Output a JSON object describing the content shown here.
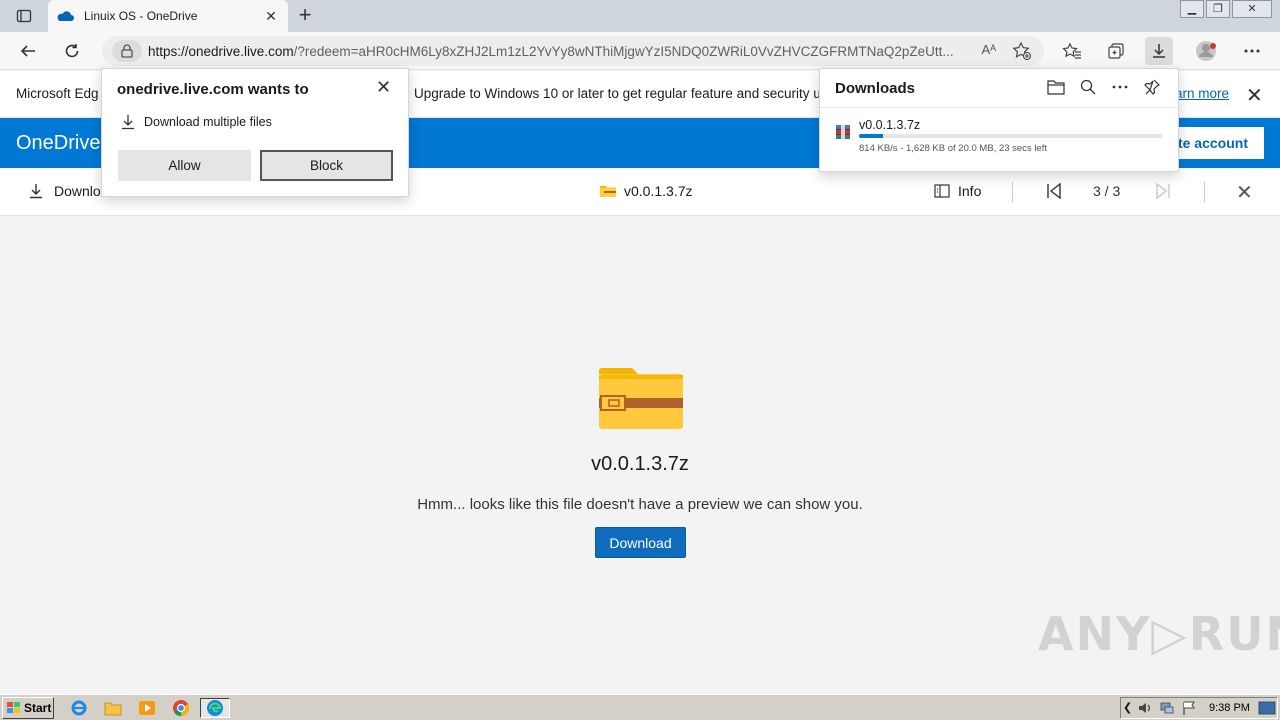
{
  "browser": {
    "tab_title": "Linuix OS - OneDrive",
    "url_host": "https://onedrive.live.com",
    "url_rest": "/?redeem=aHR0cHM6Ly8xZHJ2Lm1zL2YvYy8wNThiMjgwYzI5NDQ0ZWRiL0VvZHVCZGFRMTNaQ2pZeUtt...",
    "read_aloud": "Aᴬ"
  },
  "infobar": {
    "left_text": "Microsoft Edg",
    "middle_text": "Upgrade to Windows 10 or later to get regular feature and security u",
    "link_text": "arn more"
  },
  "onedrive": {
    "brand": "OneDrive",
    "create_account": "ate account"
  },
  "commandbar": {
    "download_label": "Downlo",
    "file_name": "v0.0.1.3.7z",
    "info_label": "Info",
    "page_counter": "3 / 3"
  },
  "preview": {
    "file_name": "v0.0.1.3.7z",
    "message": "Hmm... looks like this file doesn't have a preview we can show you.",
    "download_button": "Download"
  },
  "permission_popup": {
    "heading": "onedrive.live.com wants to",
    "request": "Download multiple files",
    "allow": "Allow",
    "block": "Block"
  },
  "downloads_panel": {
    "heading": "Downloads",
    "item_name": "v0.0.1.3.7z",
    "item_status": "814 KB/s - 1,628 KB of 20.0 MB, 23 secs left",
    "progress_fraction": 0.08
  },
  "watermark": "ANY▷RUN",
  "taskbar": {
    "start_label": "Start",
    "clock": "9:38 PM"
  }
}
